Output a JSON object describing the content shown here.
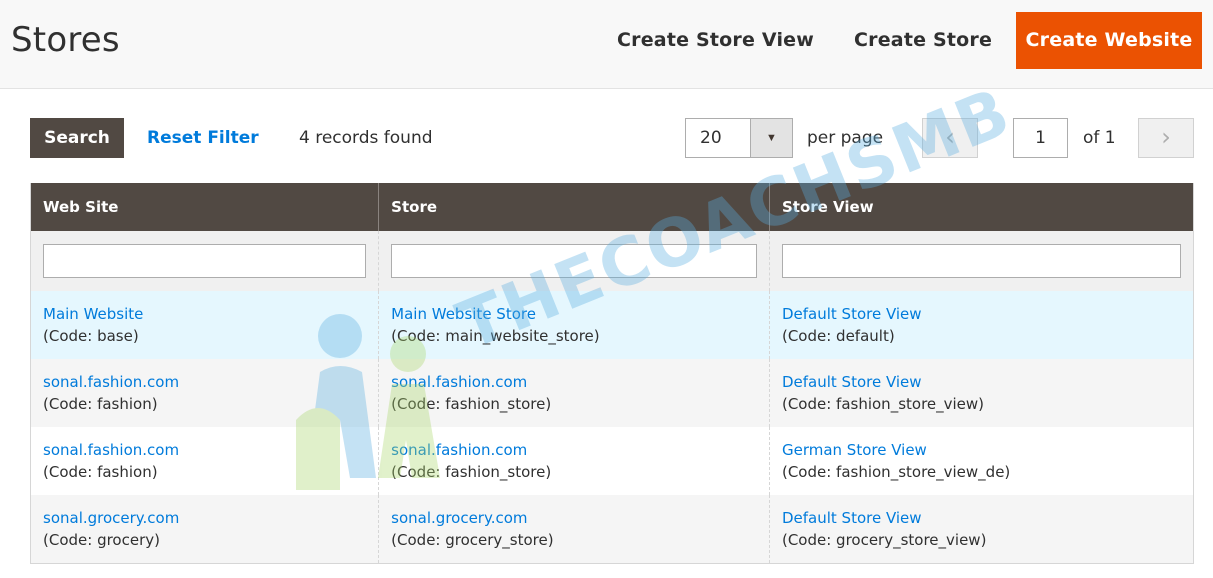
{
  "header": {
    "title": "Stores",
    "create_store_view": "Create Store View",
    "create_store": "Create Store",
    "create_website": "Create Website"
  },
  "toolbar": {
    "search_label": "Search",
    "reset_label": "Reset Filter",
    "records_found": "4 records found",
    "per_page_value": "20",
    "per_page_label": "per page",
    "page_current": "1",
    "page_total": "of 1"
  },
  "grid": {
    "columns": [
      "Web Site",
      "Store",
      "Store View"
    ],
    "rows": [
      {
        "website": "Main Website",
        "website_code": "(Code: base)",
        "store": "Main Website Store",
        "store_code": "(Code: main_website_store)",
        "view": "Default Store View",
        "view_code": "(Code: default)"
      },
      {
        "website": "sonal.fashion.com",
        "website_code": "(Code: fashion)",
        "store": "sonal.fashion.com",
        "store_code": "(Code: fashion_store)",
        "view": "Default Store View",
        "view_code": "(Code: fashion_store_view)"
      },
      {
        "website": "sonal.fashion.com",
        "website_code": "(Code: fashion)",
        "store": "sonal.fashion.com",
        "store_code": "(Code: fashion_store)",
        "view": "German Store View",
        "view_code": "(Code: fashion_store_view_de)"
      },
      {
        "website": "sonal.grocery.com",
        "website_code": "(Code: grocery)",
        "store": "sonal.grocery.com",
        "store_code": "(Code: grocery_store)",
        "view": "Default Store View",
        "view_code": "(Code: grocery_store_view)"
      }
    ]
  },
  "watermark": {
    "text": "THECOACHSMB"
  },
  "colors": {
    "accent": "#eb5202",
    "dark": "#514943",
    "link": "#007bdb"
  }
}
